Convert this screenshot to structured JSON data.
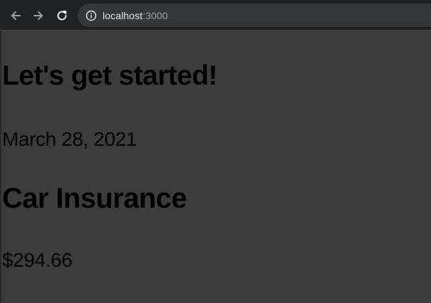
{
  "browser": {
    "url_host": "localhost",
    "url_port": ":3000",
    "icons": {
      "back": "arrow-left-icon",
      "forward": "arrow-right-icon",
      "reload": "reload-icon",
      "info": "info-icon"
    }
  },
  "page": {
    "heading": "Let's get started!",
    "date": "March 28, 2021",
    "section_title": "Car Insurance",
    "amount": "$294.66"
  },
  "colors": {
    "toolbar_bg": "#202124",
    "omnibox_bg": "#35363a",
    "page_bg": "#3c3c3c",
    "text": "#000000"
  }
}
